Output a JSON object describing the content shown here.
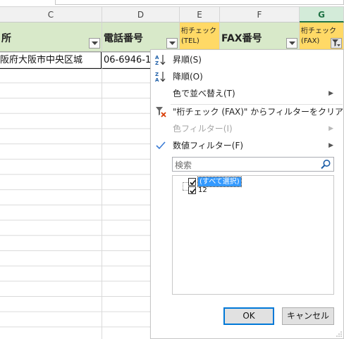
{
  "columns": [
    {
      "letter": "C",
      "selected": false
    },
    {
      "letter": "D",
      "selected": false
    },
    {
      "letter": "E",
      "selected": false
    },
    {
      "letter": "F",
      "selected": false
    },
    {
      "letter": "G",
      "selected": true
    }
  ],
  "headers": {
    "c": "所",
    "d": "電話番号",
    "e_line1": "桁チェック",
    "e_line2": "(TEL)",
    "f": "FAX番号",
    "g_line1": "桁チェック",
    "g_line2": "(FAX)"
  },
  "row1": {
    "c": "阪府大阪市中央区城",
    "d": "06-6946-1"
  },
  "menu": {
    "sort_asc": "昇順(S)",
    "sort_desc": "降順(O)",
    "sort_by_color": "色で並べ替え(T)",
    "clear_filter": "\"桁チェック (FAX)\" からフィルターをクリア(C)",
    "color_filter": "色フィルター(I)",
    "number_filter": "数値フィルター(F)",
    "search_placeholder": "検索",
    "list_items": [
      {
        "label": "(すべて選択)",
        "checked": true
      },
      {
        "label": "12",
        "checked": true
      }
    ],
    "ok": "OK",
    "cancel": "キャンセル"
  },
  "colors": {
    "header_green": "#d8e9c9",
    "header_yellow": "#ffd966",
    "excel_green": "#217346",
    "selection_blue": "#3399ff"
  },
  "icons": [
    "sort-ascending-icon",
    "sort-descending-icon",
    "clear-filter-icon",
    "checkmark-icon",
    "search-icon",
    "filter-dropdown-icon",
    "dropdown-arrow-icon"
  ]
}
